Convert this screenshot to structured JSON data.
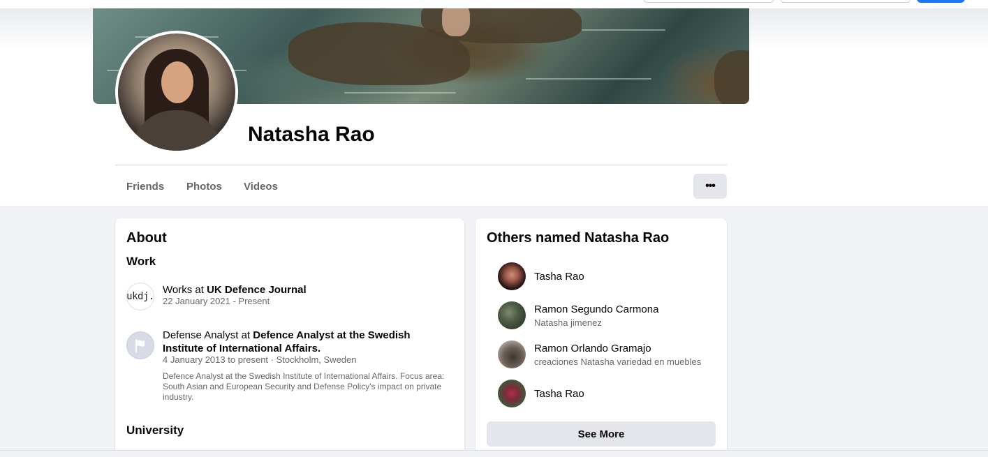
{
  "profile": {
    "name": "Natasha Rao"
  },
  "tabs": [
    {
      "label": "Friends"
    },
    {
      "label": "Photos"
    },
    {
      "label": "Videos"
    }
  ],
  "more_button": {
    "icon": "more-horizontal-icon",
    "label": "•••"
  },
  "about": {
    "title": "About",
    "work_title": "Work",
    "work": [
      {
        "logo_text": "ukdj.",
        "prefix": "Works at ",
        "org": "UK Defence Journal",
        "dates": "22 January 2021 - Present"
      },
      {
        "logo_icon": "flag-icon",
        "prefix": "Defense Analyst at ",
        "org": "Defence Analyst at the Swedish Institute of International Affairs.",
        "dates": "4 January 2013 to present · Stockholm, Sweden",
        "description": "Defence Analyst at the Swedish Institute of International Affairs. Focus area: South Asian and European Security and Defense Policy's impact on private industry."
      }
    ],
    "university_title": "University"
  },
  "others": {
    "title": "Others named Natasha Rao",
    "people": [
      {
        "name": "Tasha Rao",
        "sub": ""
      },
      {
        "name": "Ramon Segundo Carmona",
        "sub": "Natasha jimenez"
      },
      {
        "name": "Ramon Orlando Gramajo",
        "sub": "creaciones Natasha variedad en muebles"
      },
      {
        "name": "Tasha Rao",
        "sub": ""
      }
    ],
    "see_more": "See More"
  },
  "colors": {
    "accent": "#1877f2",
    "background": "#f0f2f5",
    "secondary_text": "#65676b"
  }
}
